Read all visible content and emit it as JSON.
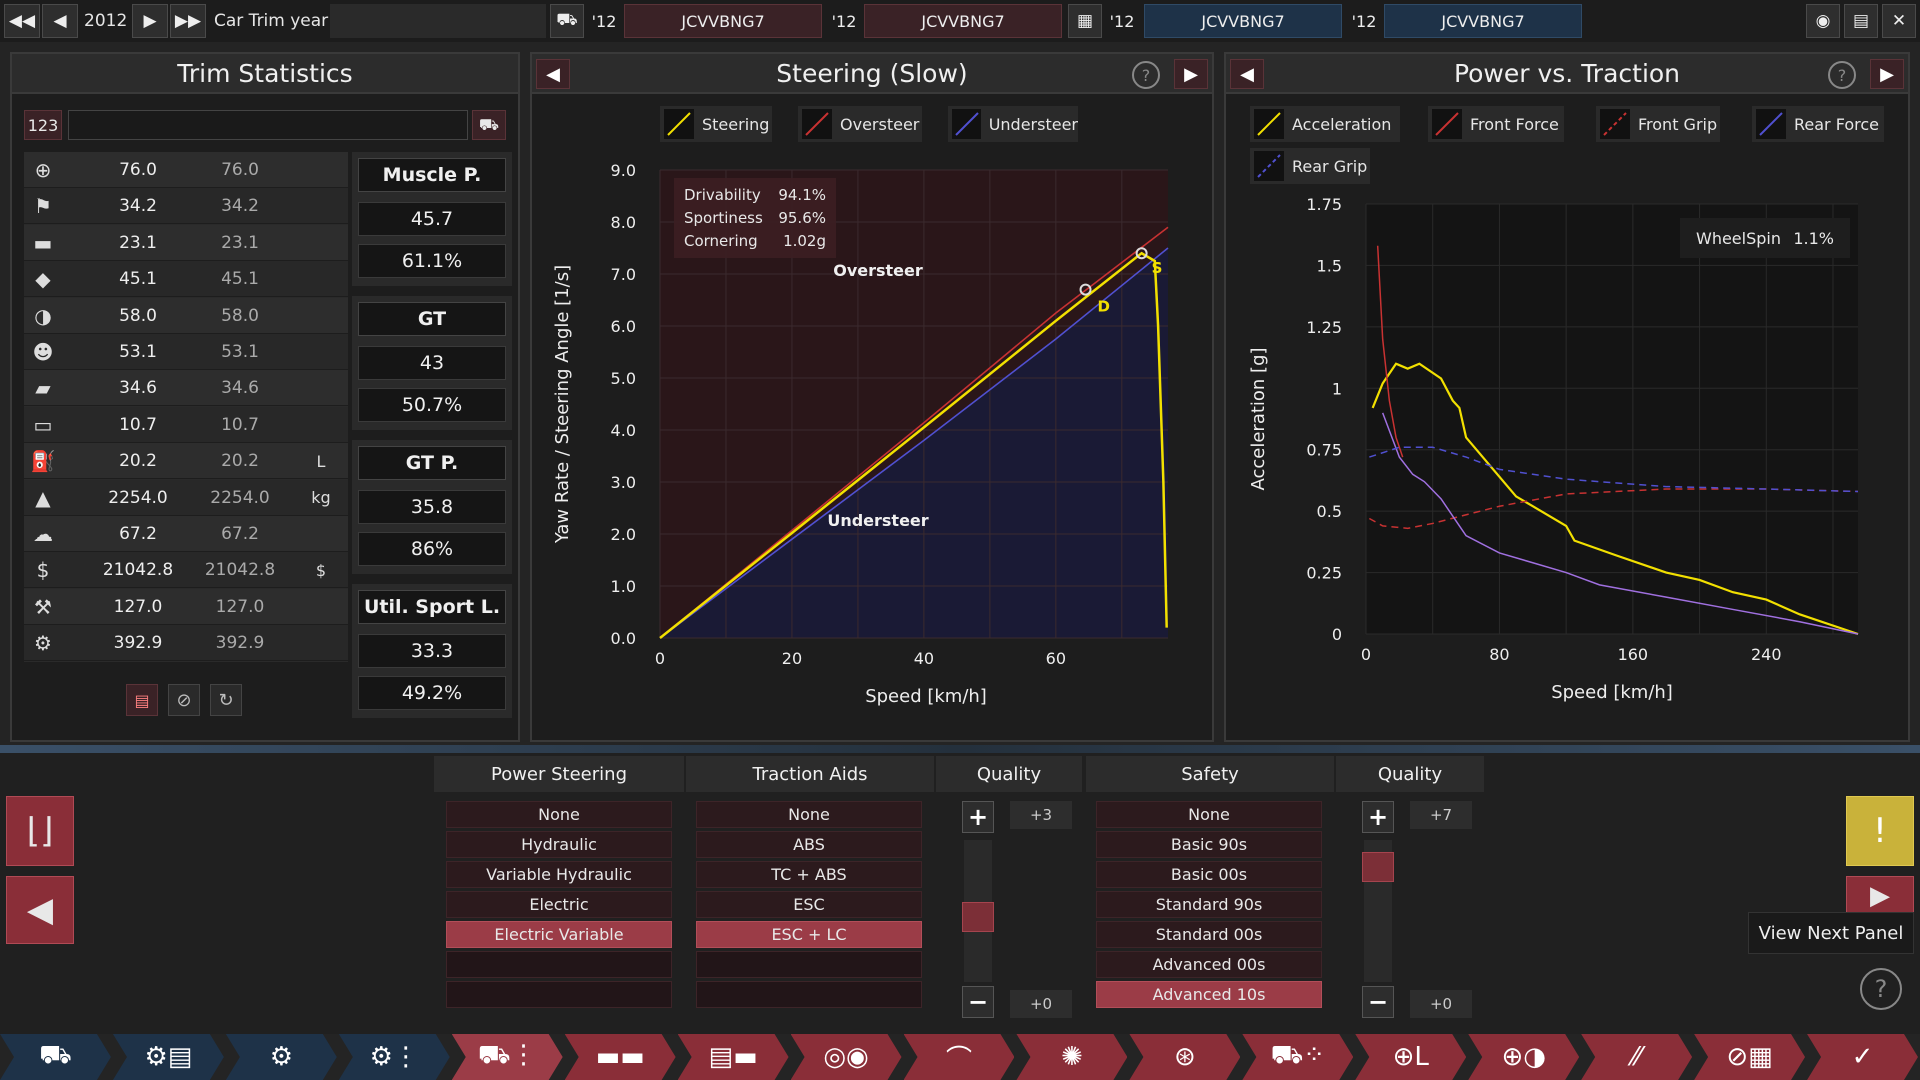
{
  "top_bar": {
    "year": "2012",
    "mode_label": "Car Trim year",
    "comparisons": [
      {
        "year": "'12",
        "name": "JCVVBNG7"
      },
      {
        "year": "'12",
        "name": "JCVVBNG7"
      },
      {
        "year": "'12",
        "name": "JCVVBNG7"
      },
      {
        "year": "'12",
        "name": "JCVVBNG7"
      }
    ],
    "icons": [
      "rewind-icon",
      "back-icon",
      "play-icon",
      "fast-forward-icon",
      "car-icon",
      "compare-icon",
      "camera-icon",
      "calculator-icon",
      "close-icon"
    ]
  },
  "trim_stats": {
    "title": "Trim Statistics",
    "counter": "123",
    "name_value": "",
    "rows": [
      {
        "icon": "steering-icon",
        "glyph": "⊕",
        "v1": "76.0",
        "v2": "76.0",
        "unit": ""
      },
      {
        "icon": "race-flag-icon",
        "glyph": "⚑",
        "v1": "34.2",
        "v2": "34.2",
        "unit": ""
      },
      {
        "icon": "seat-icon",
        "glyph": "▬",
        "v1": "23.1",
        "v2": "23.1",
        "unit": ""
      },
      {
        "icon": "gem-icon",
        "glyph": "◆",
        "v1": "45.1",
        "v2": "45.1",
        "unit": ""
      },
      {
        "icon": "wheel-icon",
        "glyph": "◑",
        "v1": "58.0",
        "v2": "58.0",
        "unit": ""
      },
      {
        "icon": "people-icon",
        "glyph": "☻",
        "v1": "53.1",
        "v2": "53.1",
        "unit": ""
      },
      {
        "icon": "truck-icon",
        "glyph": "▰",
        "v1": "34.6",
        "v2": "34.6",
        "unit": ""
      },
      {
        "icon": "car-side-icon",
        "glyph": "▭",
        "v1": "10.7",
        "v2": "10.7",
        "unit": ""
      },
      {
        "icon": "fuel-icon",
        "glyph": "⛽",
        "v1": "20.2",
        "v2": "20.2",
        "unit": "L"
      },
      {
        "icon": "weight-icon",
        "glyph": "▲",
        "v1": "2254.0",
        "v2": "2254.0",
        "unit": "kg"
      },
      {
        "icon": "emissions-icon",
        "glyph": "☁",
        "v1": "67.2",
        "v2": "67.2",
        "unit": ""
      },
      {
        "icon": "money-bag-icon",
        "glyph": "$",
        "v1": "21042.8",
        "v2": "21042.8",
        "unit": "$"
      },
      {
        "icon": "service-icon",
        "glyph": "⚒",
        "v1": "127.0",
        "v2": "127.0",
        "unit": ""
      },
      {
        "icon": "gears-icon",
        "glyph": "⚙",
        "v1": "392.9",
        "v2": "392.9",
        "unit": ""
      }
    ],
    "groups": [
      {
        "label": "Muscle P.",
        "value": "45.7",
        "percent": "61.1%"
      },
      {
        "label": "GT",
        "value": "43",
        "percent": "50.7%"
      },
      {
        "label": "GT P.",
        "value": "35.8",
        "percent": "86%"
      },
      {
        "label": "Util. Sport L.",
        "value": "33.3",
        "percent": "49.2%"
      }
    ]
  },
  "steering_panel": {
    "title": "Steering (Slow)",
    "legend": [
      {
        "label": "Steering",
        "color": "#f2e000"
      },
      {
        "label": "Oversteer",
        "color": "#c83232"
      },
      {
        "label": "Understeer",
        "color": "#5050d0"
      }
    ],
    "stats": [
      {
        "label": "Drivability",
        "value": "94.1%"
      },
      {
        "label": "Sportiness",
        "value": "95.6%"
      },
      {
        "label": "Cornering",
        "value": "1.02g"
      }
    ],
    "region_labels": {
      "oversteer": "Oversteer",
      "understeer": "Understeer"
    },
    "markers": {
      "d": "D",
      "s": "S"
    }
  },
  "power_panel": {
    "title": "Power vs. Traction",
    "legend": [
      {
        "label": "Acceleration",
        "color": "#f2e000"
      },
      {
        "label": "Front Force",
        "color": "#c83232"
      },
      {
        "label": "Front Grip",
        "color": "#c83232"
      },
      {
        "label": "Rear Force",
        "color": "#5050d0"
      },
      {
        "label": "Rear Grip",
        "color": "#5050d0"
      }
    ],
    "wheelspin_label": "WheelSpin",
    "wheelspin_value": "1.1%"
  },
  "chart_data": [
    {
      "type": "line",
      "title": "Steering (Slow)",
      "xlabel": "Speed [km/h]",
      "ylabel": "Yaw Rate / Steering Angle [1/s]",
      "xlim": [
        0,
        77
      ],
      "ylim": [
        0,
        9
      ],
      "xticks": [
        "0",
        "20",
        "40",
        "60"
      ],
      "yticks": [
        "0.0",
        "1.0",
        "2.0",
        "3.0",
        "4.0",
        "5.0",
        "6.0",
        "7.0",
        "8.0",
        "9.0"
      ],
      "grid": true,
      "series": [
        {
          "name": "Steering",
          "color": "#f2e000",
          "points": [
            [
              0,
              0
            ],
            [
              20,
              2.02
            ],
            [
              40,
              4.05
            ],
            [
              60,
              6.1
            ],
            [
              64,
              6.5
            ],
            [
              73,
              7.4
            ],
            [
              75,
              7.25
            ],
            [
              75.5,
              6.0
            ],
            [
              76.3,
              3.0
            ],
            [
              76.8,
              0.2
            ]
          ]
        },
        {
          "name": "Oversteer",
          "color": "#c83232",
          "points": [
            [
              0,
              0
            ],
            [
              20,
              2.07
            ],
            [
              40,
              4.14
            ],
            [
              60,
              6.25
            ],
            [
              77,
              7.9
            ]
          ]
        },
        {
          "name": "Understeer",
          "color": "#5050d0",
          "points": [
            [
              0,
              0
            ],
            [
              20,
              1.9
            ],
            [
              40,
              3.8
            ],
            [
              60,
              5.75
            ],
            [
              77,
              7.5
            ]
          ]
        }
      ],
      "markers": [
        {
          "label": "D",
          "x": 64.5,
          "y": 6.7
        },
        {
          "label": "S",
          "x": 73,
          "y": 7.4
        }
      ]
    },
    {
      "type": "line",
      "title": "Power vs. Traction",
      "xlabel": "Speed [km/h]",
      "ylabel": "Acceleration [g]",
      "xlim": [
        0,
        295
      ],
      "ylim": [
        0,
        1.75
      ],
      "xticks": [
        "0",
        "80",
        "160",
        "240"
      ],
      "yticks": [
        "0",
        "0.25",
        "0.5",
        "0.75",
        "1",
        "1.25",
        "1.5",
        "1.75"
      ],
      "grid": true,
      "series": [
        {
          "name": "Acceleration",
          "color": "#f2e000",
          "dashed": false,
          "points": [
            [
              4,
              0.92
            ],
            [
              10,
              1.02
            ],
            [
              18,
              1.1
            ],
            [
              25,
              1.08
            ],
            [
              32,
              1.1
            ],
            [
              45,
              1.04
            ],
            [
              52,
              0.95
            ],
            [
              56,
              0.92
            ],
            [
              60,
              0.8
            ],
            [
              75,
              0.68
            ],
            [
              90,
              0.56
            ],
            [
              100,
              0.52
            ],
            [
              120,
              0.44
            ],
            [
              125,
              0.38
            ],
            [
              150,
              0.32
            ],
            [
              180,
              0.25
            ],
            [
              200,
              0.22
            ],
            [
              220,
              0.17
            ],
            [
              240,
              0.14
            ],
            [
              260,
              0.08
            ],
            [
              295,
              0.0
            ]
          ]
        },
        {
          "name": "Front Force",
          "color": "#c83232",
          "dashed": false,
          "points": [
            [
              7,
              1.58
            ],
            [
              10,
              1.2
            ],
            [
              14,
              0.95
            ],
            [
              18,
              0.8
            ],
            [
              22,
              0.72
            ]
          ]
        },
        {
          "name": "Front Grip",
          "color": "#c83232",
          "dashed": true,
          "points": [
            [
              2,
              0.47
            ],
            [
              10,
              0.44
            ],
            [
              25,
              0.43
            ],
            [
              40,
              0.45
            ],
            [
              80,
              0.52
            ],
            [
              120,
              0.57
            ],
            [
              180,
              0.59
            ],
            [
              240,
              0.59
            ],
            [
              295,
              0.58
            ]
          ]
        },
        {
          "name": "Rear Force",
          "color": "#a070e0",
          "dashed": false,
          "points": [
            [
              10,
              0.9
            ],
            [
              20,
              0.72
            ],
            [
              28,
              0.65
            ],
            [
              35,
              0.62
            ],
            [
              45,
              0.55
            ],
            [
              55,
              0.45
            ],
            [
              60,
              0.4
            ],
            [
              80,
              0.33
            ],
            [
              100,
              0.29
            ],
            [
              120,
              0.25
            ],
            [
              140,
              0.2
            ],
            [
              180,
              0.15
            ],
            [
              220,
              0.1
            ],
            [
              260,
              0.05
            ],
            [
              295,
              0.0
            ]
          ]
        },
        {
          "name": "Rear Grip",
          "color": "#5050d0",
          "dashed": true,
          "points": [
            [
              2,
              0.72
            ],
            [
              20,
              0.76
            ],
            [
              40,
              0.76
            ],
            [
              60,
              0.72
            ],
            [
              80,
              0.67
            ],
            [
              120,
              0.63
            ],
            [
              180,
              0.6
            ],
            [
              240,
              0.59
            ],
            [
              295,
              0.58
            ]
          ]
        }
      ]
    }
  ],
  "bottom": {
    "power_steering": {
      "header": "Power Steering",
      "options": [
        "None",
        "Hydraulic",
        "Variable Hydraulic",
        "Electric",
        "Electric Variable"
      ],
      "selected": 4
    },
    "traction_aids": {
      "header": "Traction Aids",
      "options": [
        "None",
        "ABS",
        "TC + ABS",
        "ESC",
        "ESC + LC"
      ],
      "selected": 4
    },
    "quality1": {
      "header": "Quality",
      "top": "+3",
      "bottom": "+0",
      "level": 0.45
    },
    "safety": {
      "header": "Safety",
      "options": [
        "None",
        "Basic 90s",
        "Basic 00s",
        "Standard 90s",
        "Standard 00s",
        "Advanced 00s",
        "Advanced 10s"
      ],
      "selected": 6
    },
    "quality2": {
      "header": "Quality",
      "top": "+7",
      "bottom": "+0",
      "level": 0.2
    },
    "tooltip": "View Next Panel",
    "tabs": [
      "car-body-icon",
      "engine-icon",
      "engine-design-icon",
      "engine-parts-icon",
      "chassis-icon",
      "trim-icon",
      "fixtures-icon",
      "suspension-icon",
      "drivetrain-icon",
      "wheels-icon",
      "brakes-icon",
      "aero-icon",
      "interior-icon",
      "safety-icon",
      "tuning-icon",
      "testing-icon",
      "finish-icon"
    ]
  }
}
